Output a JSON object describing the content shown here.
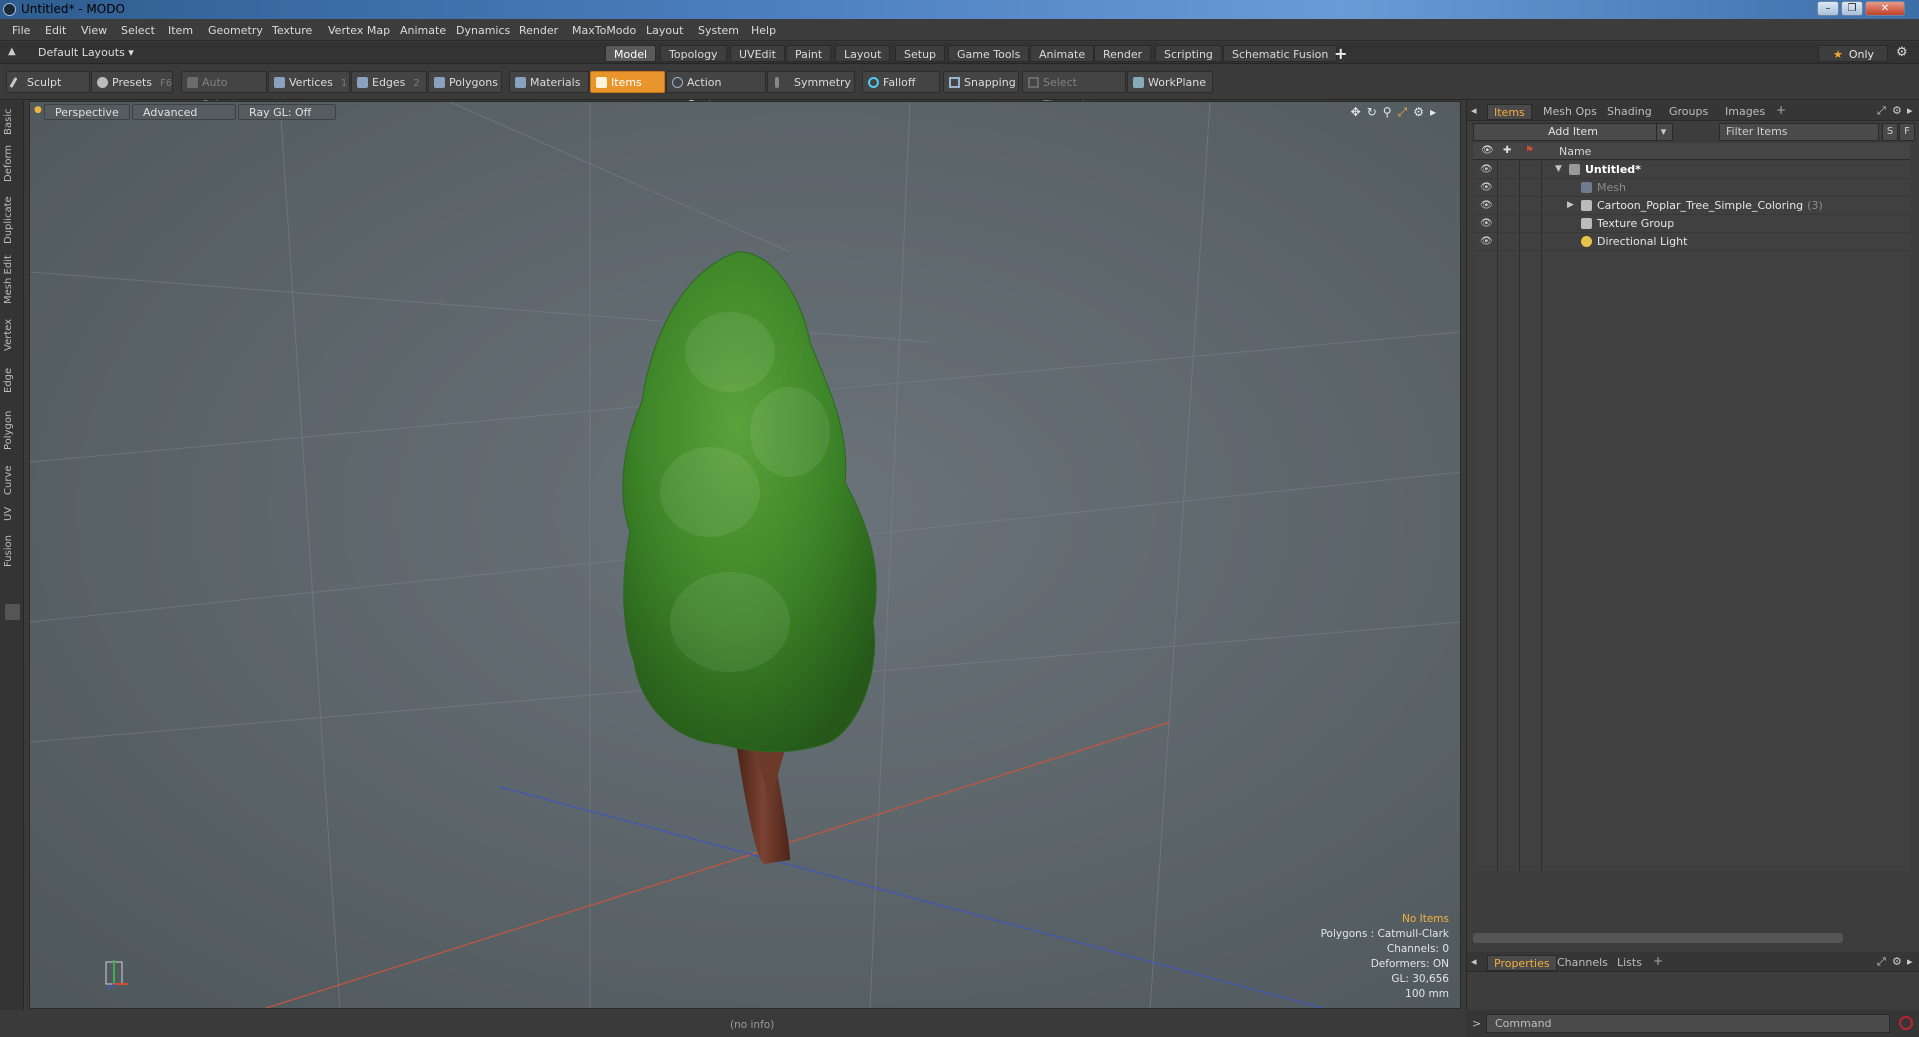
{
  "window": {
    "title": "Untitled* - MODO",
    "min": "–",
    "max": "❐",
    "close": "✕"
  },
  "menu": [
    "File",
    "Edit",
    "View",
    "Select",
    "Item",
    "Geometry",
    "Texture",
    "Vertex Map",
    "Animate",
    "Dynamics",
    "Render",
    "MaxToModo",
    "Layout",
    "System",
    "Help"
  ],
  "layouts": {
    "dropdown": "Default Layouts ▾",
    "tabs": [
      "Model",
      "Topology",
      "UVEdit",
      "Paint",
      "Layout",
      "Setup",
      "Game Tools",
      "Animate",
      "Render",
      "Scripting",
      "Schematic Fusion"
    ],
    "active": "Model",
    "add": "+",
    "only": "Only",
    "star": "★",
    "gear": "⚙"
  },
  "toolbar": {
    "sculpt": "Sculpt",
    "presets": "Presets",
    "presets_key": "F6",
    "auto_select": "Auto Select",
    "vertices": "Vertices",
    "vertices_key": "1",
    "edges": "Edges",
    "edges_key": "2",
    "polygons": "Polygons",
    "materials": "Materials",
    "items": "Items",
    "action_center": "Action Center",
    "symmetry": "Symmetry",
    "falloff": "Falloff",
    "snapping": "Snapping",
    "select_through": "Select Through",
    "workplane": "WorkPlane"
  },
  "left_tabs": [
    "Basic",
    "Deform",
    "Duplicate",
    "Mesh Edit",
    "Vertex",
    "Edge",
    "Polygon",
    "Curve",
    "UV",
    "Fusion"
  ],
  "viewport": {
    "view": "Perspective",
    "shading": "Advanced",
    "raygl": "Ray GL: Off",
    "info": {
      "selection": "No Items",
      "polygons": "Polygons : Catmull-Clark",
      "channels": "Channels: 0",
      "deformers": "Deformers: ON",
      "gl": "GL: 30,656",
      "scale": "100 mm"
    },
    "colors": {
      "foliage": "#3f8a2a",
      "trunk": "#6b3a28",
      "x_axis": "#c8553d",
      "z_axis": "#3f56b8",
      "bg": "#5b6469"
    }
  },
  "status": {
    "info": "(no info)"
  },
  "items_panel": {
    "tabs": [
      "Items",
      "Mesh Ops",
      "Shading",
      "Groups",
      "Images"
    ],
    "active_tab": "Items",
    "add_item": "Add Item",
    "filter_placeholder": "Filter Items",
    "s_btn": "S",
    "f_btn": "F",
    "name_header": "Name",
    "tree": [
      {
        "label": "Untitled*",
        "icon": "scene-icon",
        "level": 0,
        "expander": "▼"
      },
      {
        "label": "Mesh",
        "icon": "mesh-icon",
        "level": 1,
        "expander": ""
      },
      {
        "label": "Cartoon_Poplar_Tree_Simple_Coloring",
        "count": "(3)",
        "icon": "group-icon",
        "level": 1,
        "expander": "▶"
      },
      {
        "label": "Texture Group",
        "icon": "group-icon",
        "level": 1,
        "expander": ""
      },
      {
        "label": "Directional Light",
        "icon": "light-icon",
        "level": 1,
        "expander": ""
      }
    ]
  },
  "properties_panel": {
    "tabs": [
      "Properties",
      "Channels",
      "Lists"
    ],
    "active_tab": "Properties"
  },
  "command": {
    "prompt": ">",
    "placeholder": "Command"
  }
}
